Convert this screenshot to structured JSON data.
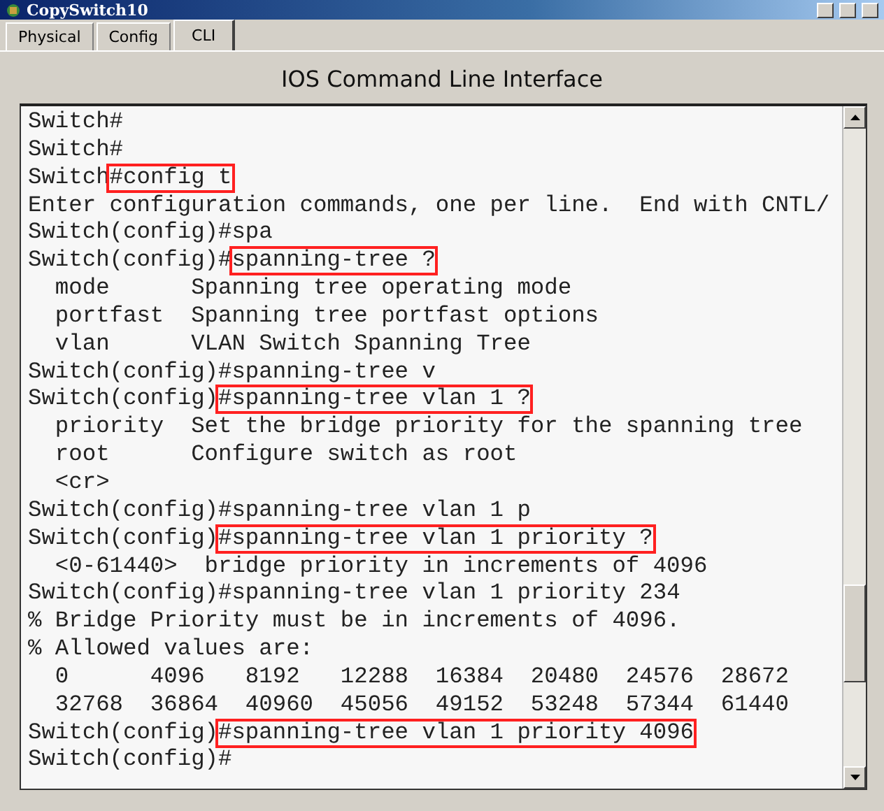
{
  "window": {
    "title": "CopySwitch10"
  },
  "tabs": [
    {
      "label": "Physical",
      "selected": false
    },
    {
      "label": "Config",
      "selected": false
    },
    {
      "label": "CLI",
      "selected": true
    }
  ],
  "heading": "IOS Command Line Interface",
  "terminal": {
    "lines": [
      {
        "prompt": "Switch#",
        "highlighted": false
      },
      {
        "prompt": "Switch#",
        "highlighted": false
      },
      {
        "prompt": "Switch",
        "text": "#config t",
        "highlighted": true
      },
      {
        "text": "Enter configuration commands, one per line.  End with CNTL/",
        "highlighted": false
      },
      {
        "prompt": "Switch(config)#",
        "text": "spa",
        "highlighted": false
      },
      {
        "prompt": "Switch(config)#",
        "text": "spanning-tree ?",
        "highlighted": true
      },
      {
        "text": "  mode      Spanning tree operating mode",
        "highlighted": false
      },
      {
        "text": "  portfast  Spanning tree portfast options",
        "highlighted": false
      },
      {
        "text": "  vlan      VLAN Switch Spanning Tree",
        "highlighted": false
      },
      {
        "prompt": "Switch(config)#",
        "text": "spanning-tree v",
        "highlighted": false
      },
      {
        "prompt": "Switch(config)",
        "text": "#spanning-tree vlan 1 ?",
        "highlighted": true
      },
      {
        "text": "  priority  Set the bridge priority for the spanning tree",
        "highlighted": false
      },
      {
        "text": "  root      Configure switch as root",
        "highlighted": false
      },
      {
        "text": "  <cr>",
        "highlighted": false
      },
      {
        "prompt": "Switch(config)#",
        "text": "spanning-tree vlan 1 p",
        "highlighted": false
      },
      {
        "prompt": "Switch(config)",
        "text": "#spanning-tree vlan 1 priority ?",
        "highlighted": true
      },
      {
        "text": "  <0-61440>  bridge priority in increments of 4096",
        "highlighted": false
      },
      {
        "prompt": "Switch(config)#",
        "text": "spanning-tree vlan 1 priority 234",
        "highlighted": false
      },
      {
        "text": "% Bridge Priority must be in increments of 4096.",
        "highlighted": false
      },
      {
        "text": "% Allowed values are:",
        "highlighted": false
      },
      {
        "text": "  0      4096   8192   12288  16384  20480  24576  28672",
        "highlighted": false
      },
      {
        "text": "  32768  36864  40960  45056  49152  53248  57344  61440",
        "highlighted": false
      },
      {
        "prompt": "Switch(config)",
        "text": "#spanning-tree vlan 1 priority 4096",
        "highlighted": true
      },
      {
        "prompt": "Switch(config)#",
        "highlighted": false
      }
    ]
  }
}
